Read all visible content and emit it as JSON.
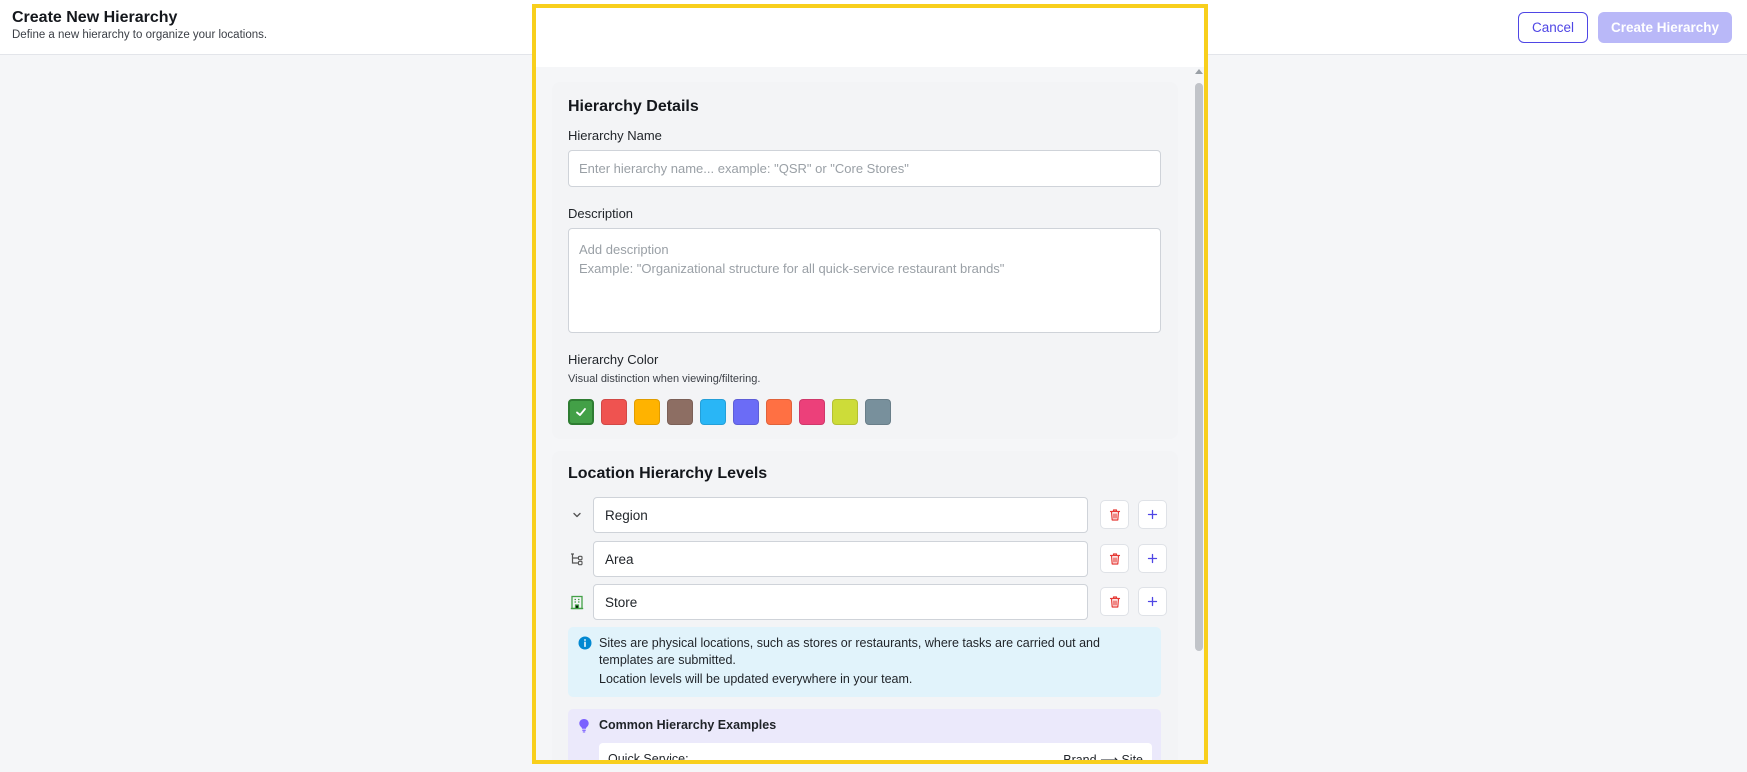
{
  "header": {
    "title": "Create New Hierarchy",
    "subtitle": "Define a new hierarchy to organize your locations.",
    "cancel_label": "Cancel",
    "create_label": "Create Hierarchy"
  },
  "details": {
    "section_title": "Hierarchy Details",
    "name_label": "Hierarchy Name",
    "name_placeholder": "Enter hierarchy name... example: \"QSR\" or \"Core Stores\"",
    "name_value": "",
    "description_label": "Description",
    "description_placeholder_line1": "Add description",
    "description_placeholder_line2": "Example: \"Organizational structure for all quick-service restaurant brands\"",
    "color_label": "Hierarchy Color",
    "color_hint": "Visual distinction when viewing/filtering.",
    "colors": [
      "#43a047",
      "#ef5350",
      "#ffb300",
      "#8d6e63",
      "#29b6f6",
      "#6b6cf6",
      "#ff7043",
      "#ec407a",
      "#cddc39",
      "#78909c"
    ],
    "selected_color_index": 0
  },
  "levels": {
    "section_title": "Location Hierarchy Levels",
    "items": [
      {
        "name": "Region",
        "icon": "chevron-down-icon"
      },
      {
        "name": "Area",
        "icon": "hierarchy-branch-icon"
      },
      {
        "name": "Store",
        "icon": "building-icon"
      }
    ],
    "info_bold1": "Sites",
    "info_text1": " are physical locations, such as stores or restaurants, where tasks are carried out and templates are submitted.",
    "info_bold2": "Location levels",
    "info_text2": " will be updated everywhere in your team.",
    "examples_title": "Common Hierarchy Examples",
    "examples": [
      {
        "name": "Quick Service:",
        "path": "Brand ⟶ Site"
      }
    ]
  },
  "colors": {
    "accent": "#4f46e5",
    "disabled_accent": "#b9b8f8",
    "highlight": "#f8cf1c",
    "delete": "#e53935"
  }
}
